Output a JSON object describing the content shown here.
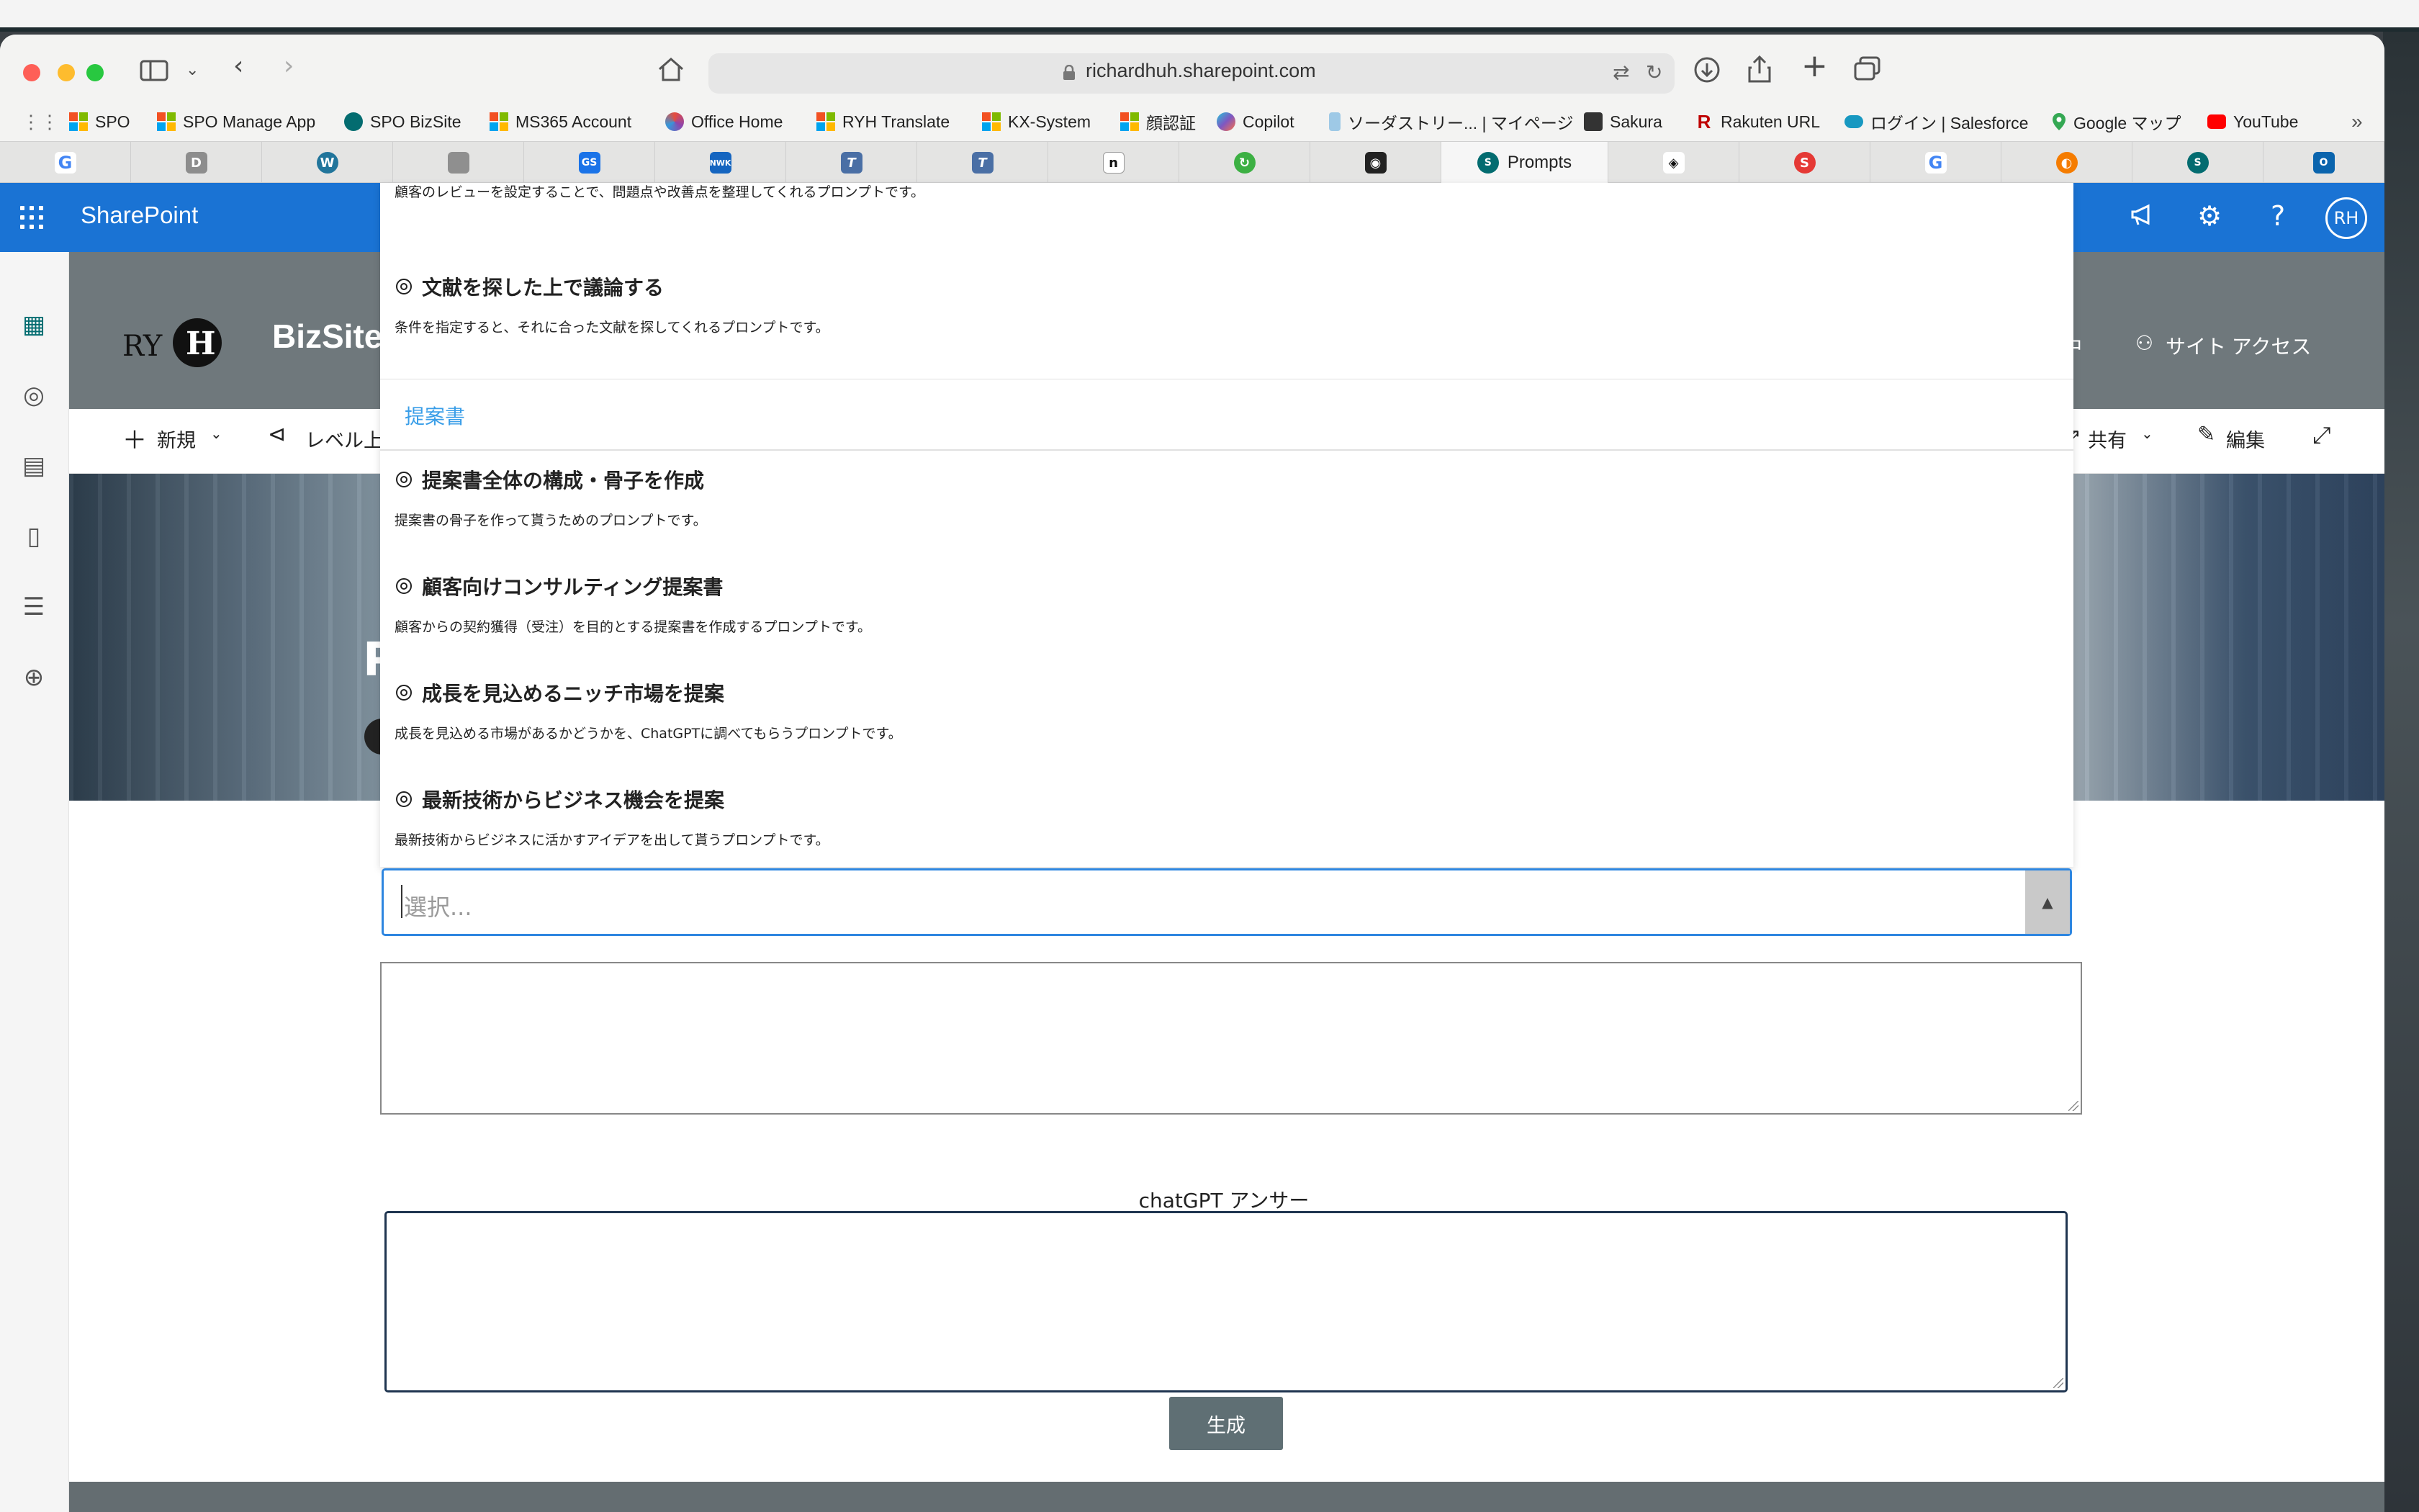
{
  "browser": {
    "url": "richardhuh.sharepoint.com",
    "bookmarks": [
      {
        "label": "SPO",
        "icon": "microsoft-logo-icon"
      },
      {
        "label": "SPO Manage App",
        "icon": "microsoft-logo-icon"
      },
      {
        "label": "SPO BizSite",
        "icon": "sharepoint-icon"
      },
      {
        "label": "MS365 Account",
        "icon": "microsoft-logo-icon"
      },
      {
        "label": "Office Home",
        "icon": "office-icon"
      },
      {
        "label": "RYH Translate",
        "icon": "microsoft-logo-icon"
      },
      {
        "label": "KX-System",
        "icon": "microsoft-logo-icon"
      },
      {
        "label": "顔認証",
        "icon": "microsoft-logo-icon"
      },
      {
        "label": "Copilot",
        "icon": "copilot-icon"
      },
      {
        "label": "ソーダストリー... | マイページ",
        "icon": "bottle-icon"
      },
      {
        "label": "Sakura",
        "icon": "sakura-icon"
      },
      {
        "label": "Rakuten URL",
        "icon": "rakuten-icon"
      },
      {
        "label": "ログイン | Salesforce",
        "icon": "salesforce-icon"
      },
      {
        "label": "Google マップ",
        "icon": "maps-pin-icon"
      },
      {
        "label": "YouTube",
        "icon": "youtube-icon"
      }
    ],
    "active_tab": "Prompts"
  },
  "sharepoint": {
    "app_name": "SharePoint",
    "site_name": "BizSite",
    "site_right": [
      "中",
      "サイト アクセス"
    ],
    "avatar": "RH",
    "commands": {
      "new": "新規",
      "level_up": "レベル上",
      "share": "共有",
      "edit": "編集"
    },
    "hero_letter": "P"
  },
  "prompt_list": {
    "partial_desc": "顧客のレビューを設定することで、問題点や改善点を整理してくれるプロンプトです。",
    "items_before": [
      {
        "title": "文献を探した上で議論する",
        "desc": "条件を指定すると、それに合った文献を探してくれるプロンプトです。"
      }
    ],
    "group": "提案書",
    "items": [
      {
        "title": "提案書全体の構成・骨子を作成",
        "desc": "提案書の骨子を作って貰うためのプロンプトです。"
      },
      {
        "title": "顧客向けコンサルティング提案書",
        "desc": "顧客からの契約獲得（受注）を目的とする提案書を作成するプロンプトです。"
      },
      {
        "title": "成長を見込めるニッチ市場を提案",
        "desc": "成長を見込める市場があるかどうかを、ChatGPTに調べてもらうプロンプトです。"
      },
      {
        "title": "最新技術からビジネス機会を提案",
        "desc": "最新技術からビジネスに活かすアイデアを出して貰うプロンプトです。"
      }
    ]
  },
  "form": {
    "select_placeholder": "選択...",
    "prompt_value": "",
    "answer_label": "chatGPT アンサー",
    "answer_value": "",
    "generate_label": "生成"
  },
  "colors": {
    "sharepoint_blue": "#1a73d4",
    "site_header": "#6f787c",
    "group_blue": "#3a9ee8",
    "select_focus": "#2e86e0",
    "button": "#5f6f74"
  }
}
